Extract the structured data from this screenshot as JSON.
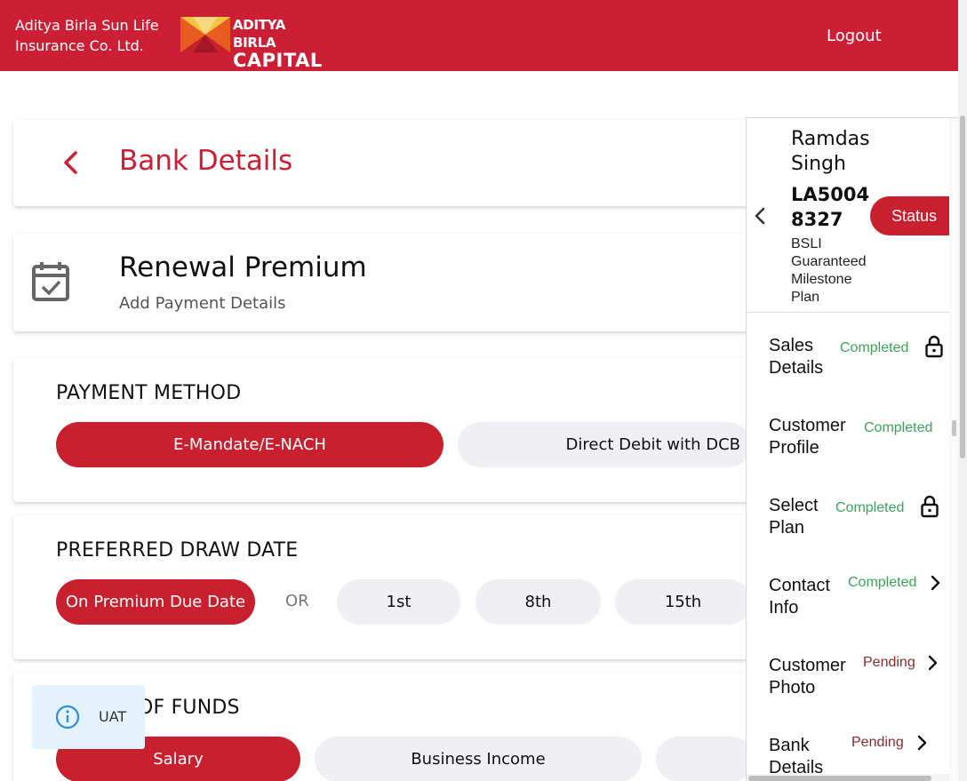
{
  "header": {
    "company_line1": "Aditya Birla Sun Life",
    "company_line2": "Insurance Co. Ltd.",
    "logo_line1": "ADITYA BIRLA",
    "logo_line2": "CAPITAL",
    "logout_label": "Logout",
    "brand_color": "#cc1f36"
  },
  "page": {
    "title": "Bank Details",
    "back_icon": "chevron-left-icon"
  },
  "renewal": {
    "title": "Renewal Premium",
    "subtitle": "Add Payment Details",
    "icon": "calendar-check-icon"
  },
  "payment_method": {
    "title": "PAYMENT METHOD",
    "options": [
      "E-Mandate/E-NACH",
      "Direct Debit with DCB"
    ],
    "selected": "E-Mandate/E-NACH"
  },
  "draw_date": {
    "title": "PREFERRED DRAW DATE",
    "primary": "On Premium Due Date",
    "or_label": "OR",
    "options": [
      "1st",
      "8th",
      "15th"
    ],
    "selected": "On Premium Due Date"
  },
  "funds": {
    "title_visible": "OF FUNDS",
    "options": [
      "Salary",
      "Business Income"
    ],
    "selected": "Salary"
  },
  "uat": {
    "label": "UAT",
    "icon": "info-icon"
  },
  "side_panel": {
    "name_line1": "Ramdas",
    "name_line2": "Singh",
    "policy_line1": "LA5004",
    "policy_line2": "8327",
    "plan_lines": [
      "BSLI",
      "Guaranteed",
      "Milestone",
      "Plan"
    ],
    "status_label": "Status",
    "steps": [
      {
        "label_line1": "Sales",
        "label_line2": "Details",
        "status": "Completed",
        "icon": "lock-icon"
      },
      {
        "label_line1": "Customer",
        "label_line2": "Profile",
        "status": "Completed",
        "icon": "none"
      },
      {
        "label_line1": "Select",
        "label_line2": "Plan",
        "status": "Completed",
        "icon": "lock-icon"
      },
      {
        "label_line1": "Contact",
        "label_line2": "Info",
        "status": "Completed",
        "icon": "chevron-right-icon"
      },
      {
        "label_line1": "Customer",
        "label_line2": "Photo",
        "status": "Pending",
        "icon": "chevron-right-icon"
      },
      {
        "label_line1": "Bank",
        "label_line2": "Details",
        "status": "Pending",
        "icon": "chevron-right-icon"
      }
    ],
    "completed_color": "#3ba45a",
    "pending_color": "#8b2a2a"
  }
}
